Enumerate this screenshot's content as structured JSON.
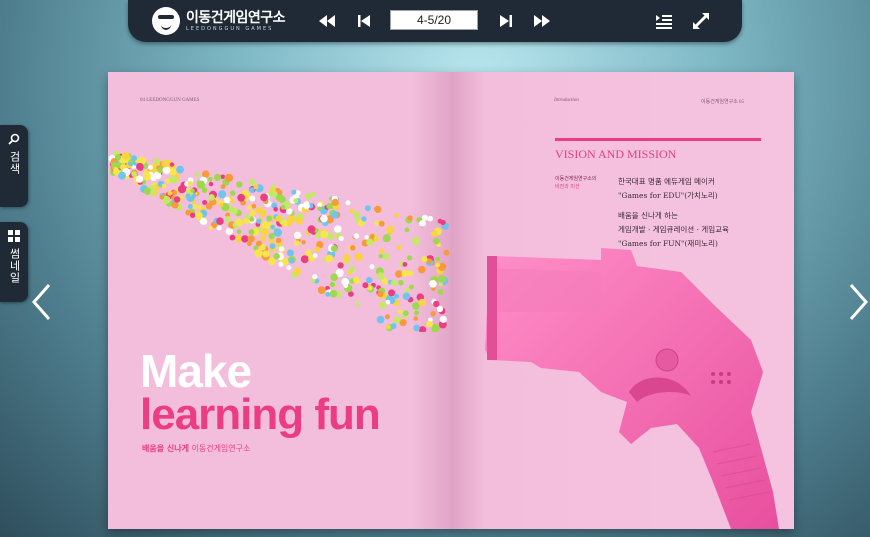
{
  "topbar": {
    "logo_title": "이동건게임연구소",
    "logo_sub": "LEEDONGGUN GAMES",
    "page_indicator": "4-5/20"
  },
  "sidebar": {
    "search_label": "검색",
    "thumbnail_label": "썸네일"
  },
  "book": {
    "left": {
      "folio": "04  LEEDONGGUN GAMES",
      "headline_1": "Make",
      "headline_2": "learning fun",
      "tagline_strong": "배움을 신나게",
      "tagline_rest": " 이동건게임연구소"
    },
    "right": {
      "section": "Introduction",
      "folio": "이동건게임연구소 05",
      "heading": "VISION AND MISSION",
      "label_1": "이동건게임연구소의",
      "label_2": "비전과 미션",
      "line_1": "한국대표 명품 에듀게임 메이커",
      "line_2": "\"Games for EDU\"(가치노리)",
      "line_3": "배움을 신나게 하는",
      "line_4": "게임개발 · 게임큐레이션 · 게임교육",
      "line_5": "\"Games for FUN\"(재미노리)"
    }
  },
  "colors": {
    "accent": "#ec3d83",
    "toolbar": "#1f2a36",
    "page": "#f3bedc",
    "gun": "#f06bb0"
  }
}
